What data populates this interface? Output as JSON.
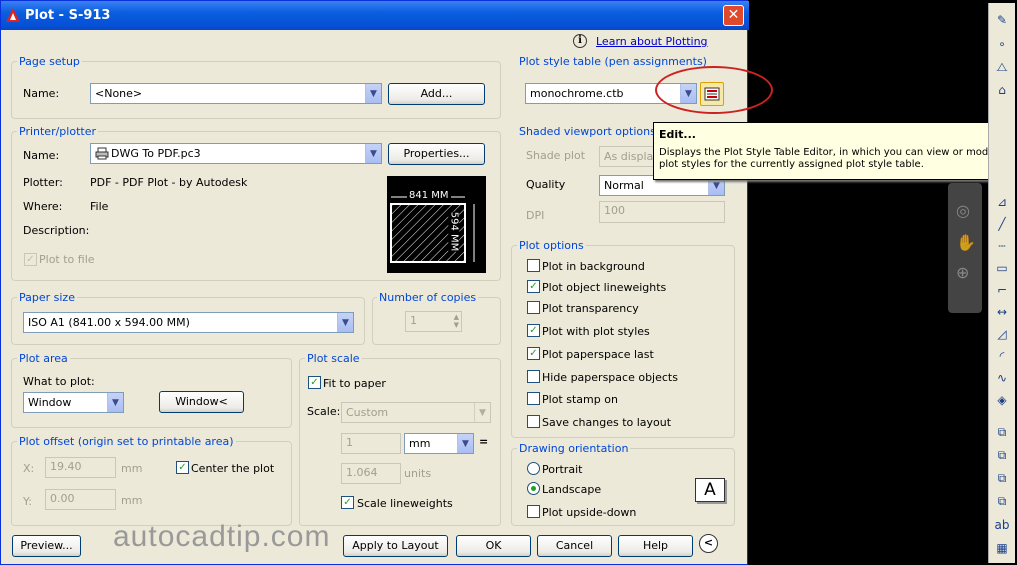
{
  "window": {
    "title": "Plot - S-913",
    "close": "✕"
  },
  "help_link": "Learn about Plotting",
  "page_setup": {
    "group": "Page setup",
    "name_label": "Name:",
    "name_value": "<None>",
    "add_button": "Add..."
  },
  "plot_style": {
    "group": "Plot style table (pen assignments)",
    "value": "monochrome.ctb"
  },
  "tooltip": {
    "title": "Edit...",
    "text": "Displays the Plot Style Table Editor, in which you can view or modify plot styles for the currently assigned plot style table."
  },
  "printer": {
    "group": "Printer/plotter",
    "name_label": "Name:",
    "name_value": "DWG To PDF.pc3",
    "properties_button": "Properties...",
    "plotter_label": "Plotter:",
    "plotter_value": "PDF - PDF Plot - by Autodesk",
    "where_label": "Where:",
    "where_value": "File",
    "description_label": "Description:",
    "plot_to_file": "Plot to file",
    "preview_width": "841 MM",
    "preview_height": "594 MM"
  },
  "shaded": {
    "group": "Shaded viewport options",
    "shade_label": "Shade plot",
    "shade_value": "As displayed",
    "quality_label": "Quality",
    "quality_value": "Normal",
    "dpi_label": "DPI",
    "dpi_value": "100"
  },
  "paper_size": {
    "group": "Paper size",
    "value": "ISO A1 (841.00 x 594.00 MM)"
  },
  "copies": {
    "group": "Number of copies",
    "value": "1"
  },
  "plot_options": {
    "group": "Plot options",
    "items": [
      {
        "label": "Plot in background",
        "checked": false
      },
      {
        "label": "Plot object lineweights",
        "checked": true
      },
      {
        "label": "Plot transparency",
        "checked": false
      },
      {
        "label": "Plot with plot styles",
        "checked": true
      },
      {
        "label": "Plot paperspace last",
        "checked": true
      },
      {
        "label": "Hide paperspace objects",
        "checked": false
      },
      {
        "label": "Plot stamp on",
        "checked": false
      },
      {
        "label": "Save changes to layout",
        "checked": false
      }
    ]
  },
  "plot_area": {
    "group": "Plot area",
    "what_label": "What to plot:",
    "what_value": "Window",
    "window_button": "Window<"
  },
  "plot_scale": {
    "group": "Plot scale",
    "fit_to_paper": "Fit to paper",
    "scale_label": "Scale:",
    "scale_value": "Custom",
    "num_value": "1",
    "unit_value": "mm",
    "eq": "=",
    "units_value": "1.064",
    "units_label": "units",
    "scale_lineweights": "Scale lineweights"
  },
  "plot_offset": {
    "group": "Plot offset (origin set to printable area)",
    "x_label": "X:",
    "x_value": "19.40",
    "x_unit": "mm",
    "y_label": "Y:",
    "y_value": "0.00",
    "y_unit": "mm",
    "center": "Center the plot"
  },
  "orientation": {
    "group": "Drawing orientation",
    "portrait": "Portrait",
    "landscape": "Landscape",
    "upside_down": "Plot upside-down",
    "icon_letter": "A"
  },
  "buttons": {
    "preview": "Preview...",
    "apply": "Apply to Layout",
    "ok": "OK",
    "cancel": "Cancel",
    "help": "Help"
  },
  "watermark": "autocadtip.com",
  "colors": {
    "title_bar": "#0a5ee0",
    "group_label": "#0046d5",
    "highlight": "#cc2222"
  }
}
